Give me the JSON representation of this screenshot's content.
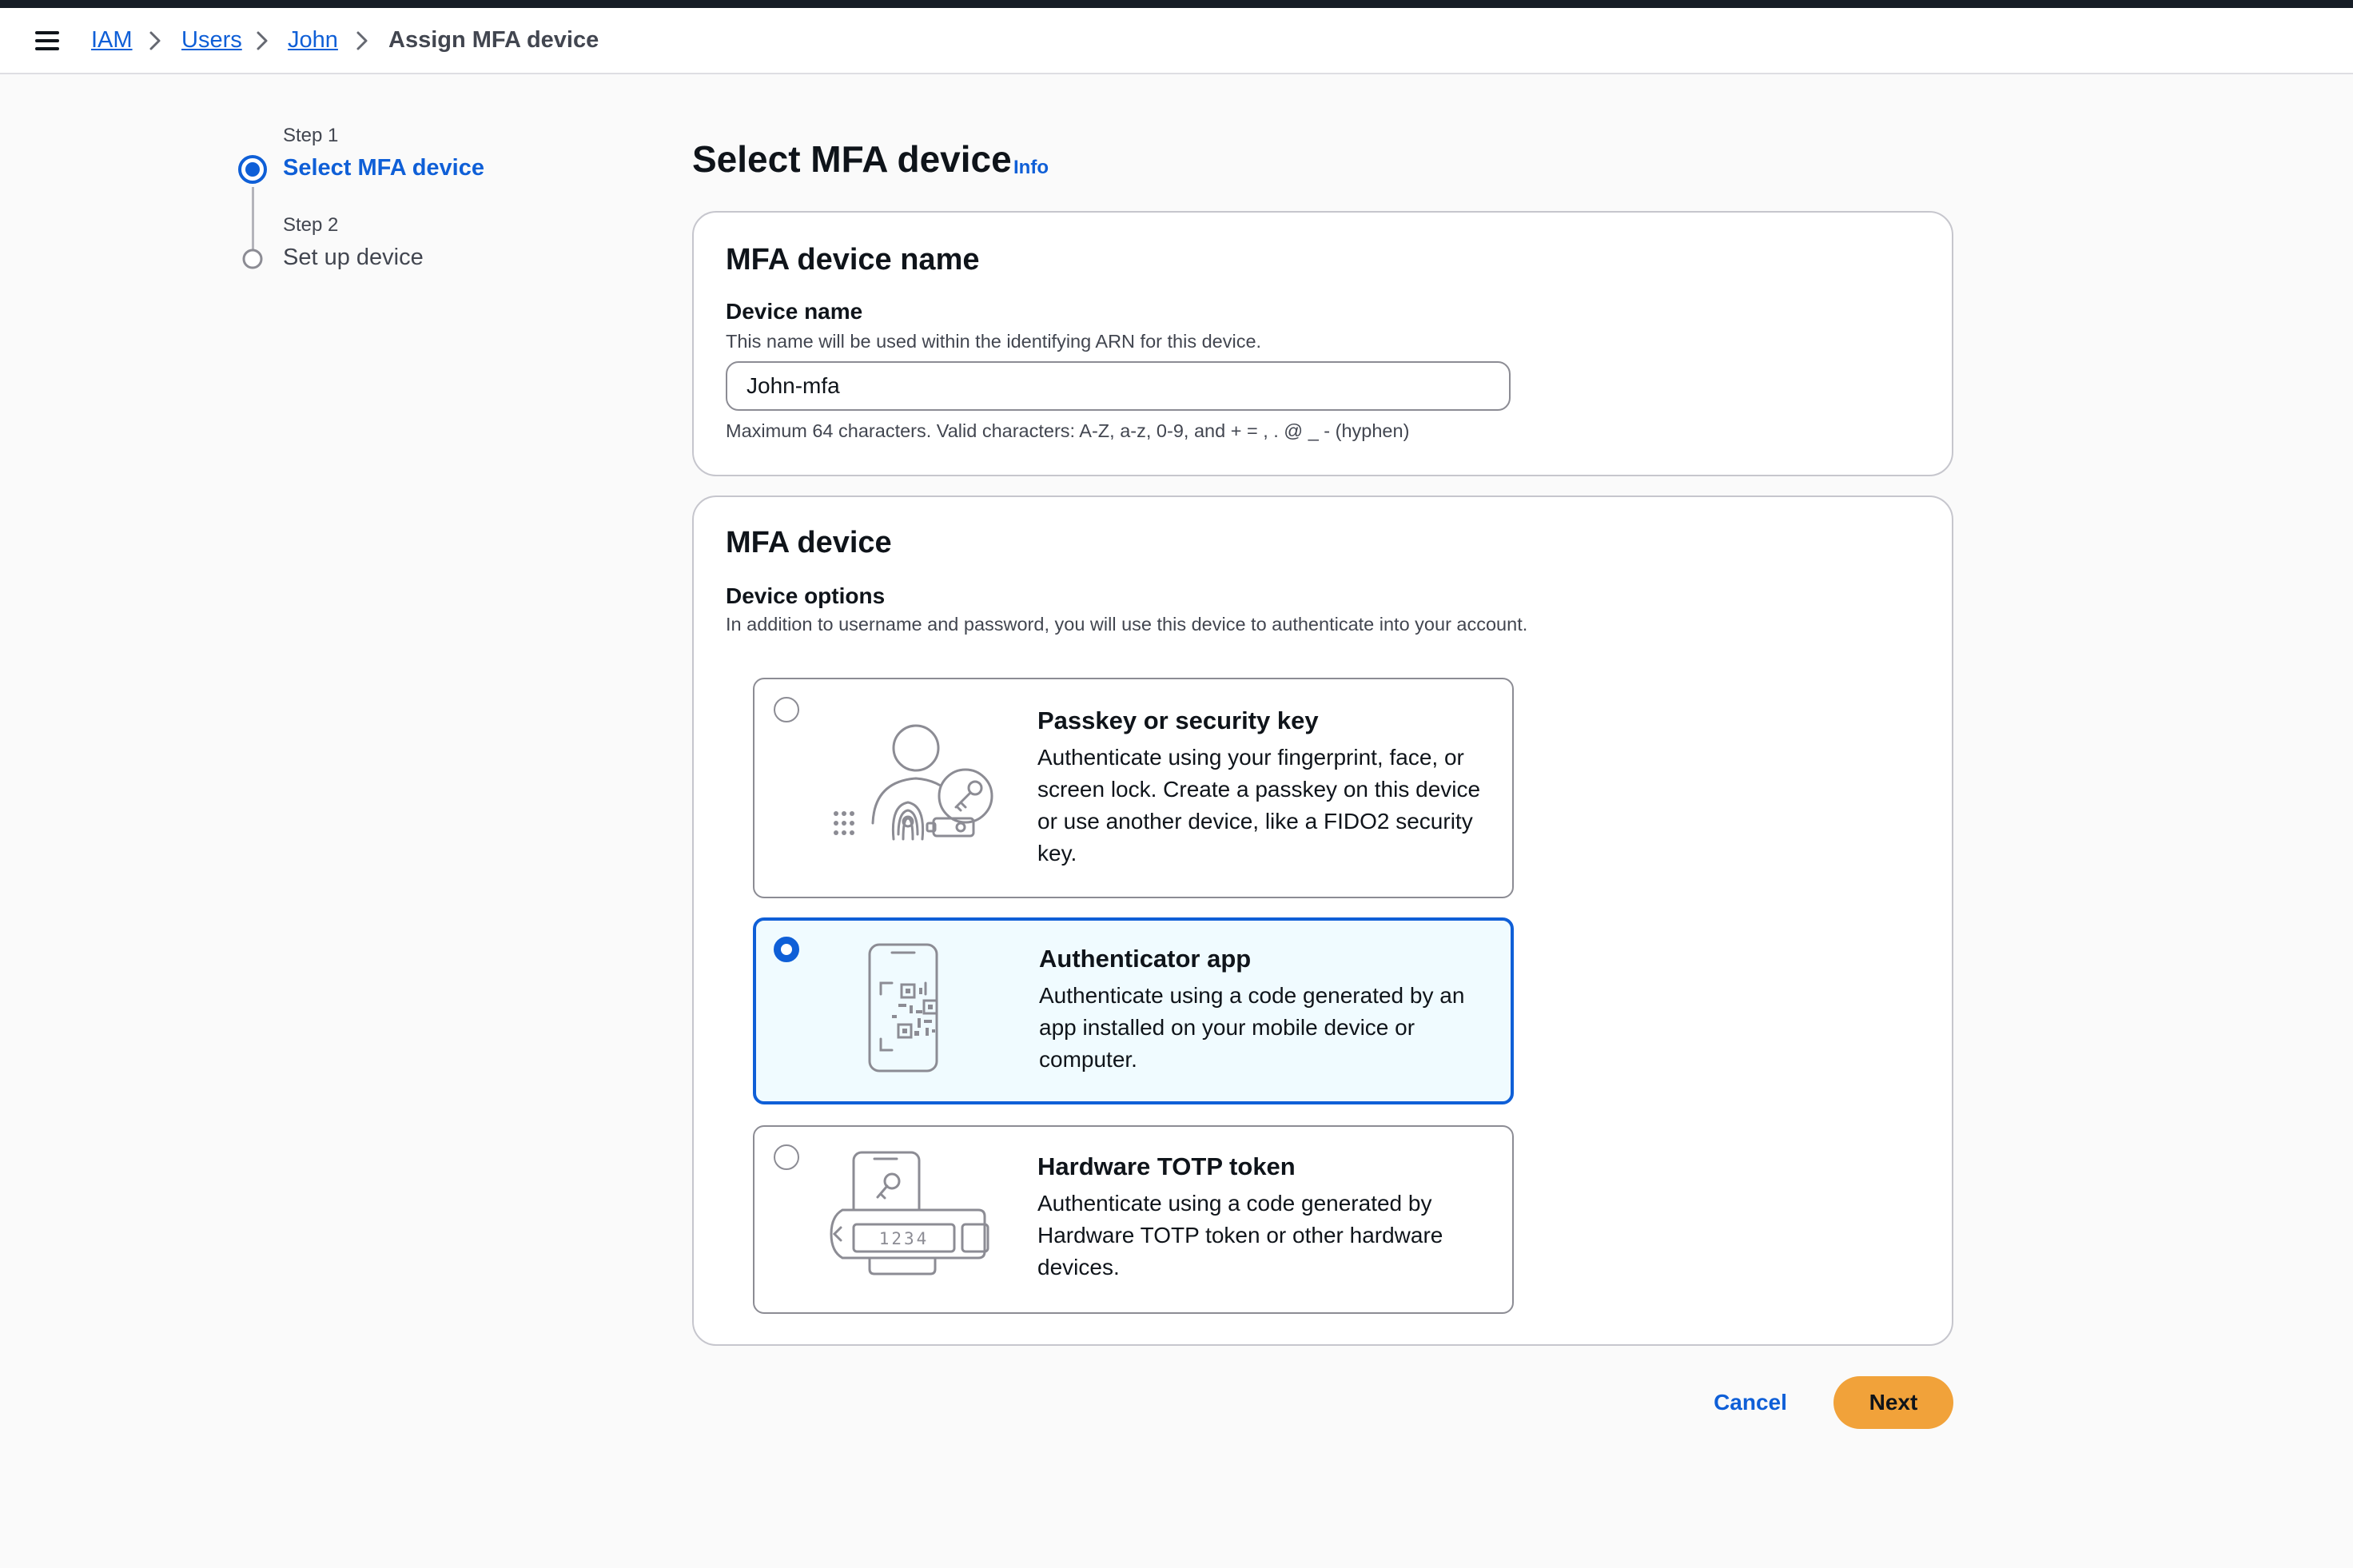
{
  "breadcrumb": {
    "items": [
      "IAM",
      "Users",
      "John"
    ],
    "current": "Assign MFA device"
  },
  "steps": [
    {
      "caption": "Step 1",
      "title": "Select MFA device",
      "state": "active"
    },
    {
      "caption": "Step 2",
      "title": "Set up device",
      "state": "inactive"
    }
  ],
  "page": {
    "title": "Select MFA device",
    "info_link": "Info"
  },
  "name_panel": {
    "title": "MFA device name",
    "field_label": "Device name",
    "field_description": "This name will be used within the identifying ARN for this device.",
    "value": "John-mfa",
    "constraint": "Maximum 64 characters. Valid characters: A-Z, a-z, 0-9, and + = , . @ _ - (hyphen)"
  },
  "device_panel": {
    "title": "MFA device",
    "options_label": "Device options",
    "options_description": "In addition to username and password, you will use this device to authenticate into your account.",
    "options": [
      {
        "title": "Passkey or security key",
        "description": "Authenticate using your fingerprint, face, or screen lock. Create a passkey on this device or use another device, like a FIDO2 security key.",
        "selected": false,
        "icon": "passkey-icon"
      },
      {
        "title": "Authenticator app",
        "description": "Authenticate using a code generated by an app installed on your mobile device or computer.",
        "selected": true,
        "icon": "authenticator-app-icon"
      },
      {
        "title": "Hardware TOTP token",
        "description": "Authenticate using a code generated by Hardware TOTP token or other hardware devices.",
        "selected": false,
        "icon": "hardware-token-icon",
        "token_display": "1234"
      }
    ]
  },
  "actions": {
    "cancel_label": "Cancel",
    "next_label": "Next"
  },
  "colors": {
    "link": "#0f5fd7",
    "primary_button": "#f1a23a",
    "selected_tile_bg": "#f0fbff",
    "top_strip": "#161d26"
  }
}
